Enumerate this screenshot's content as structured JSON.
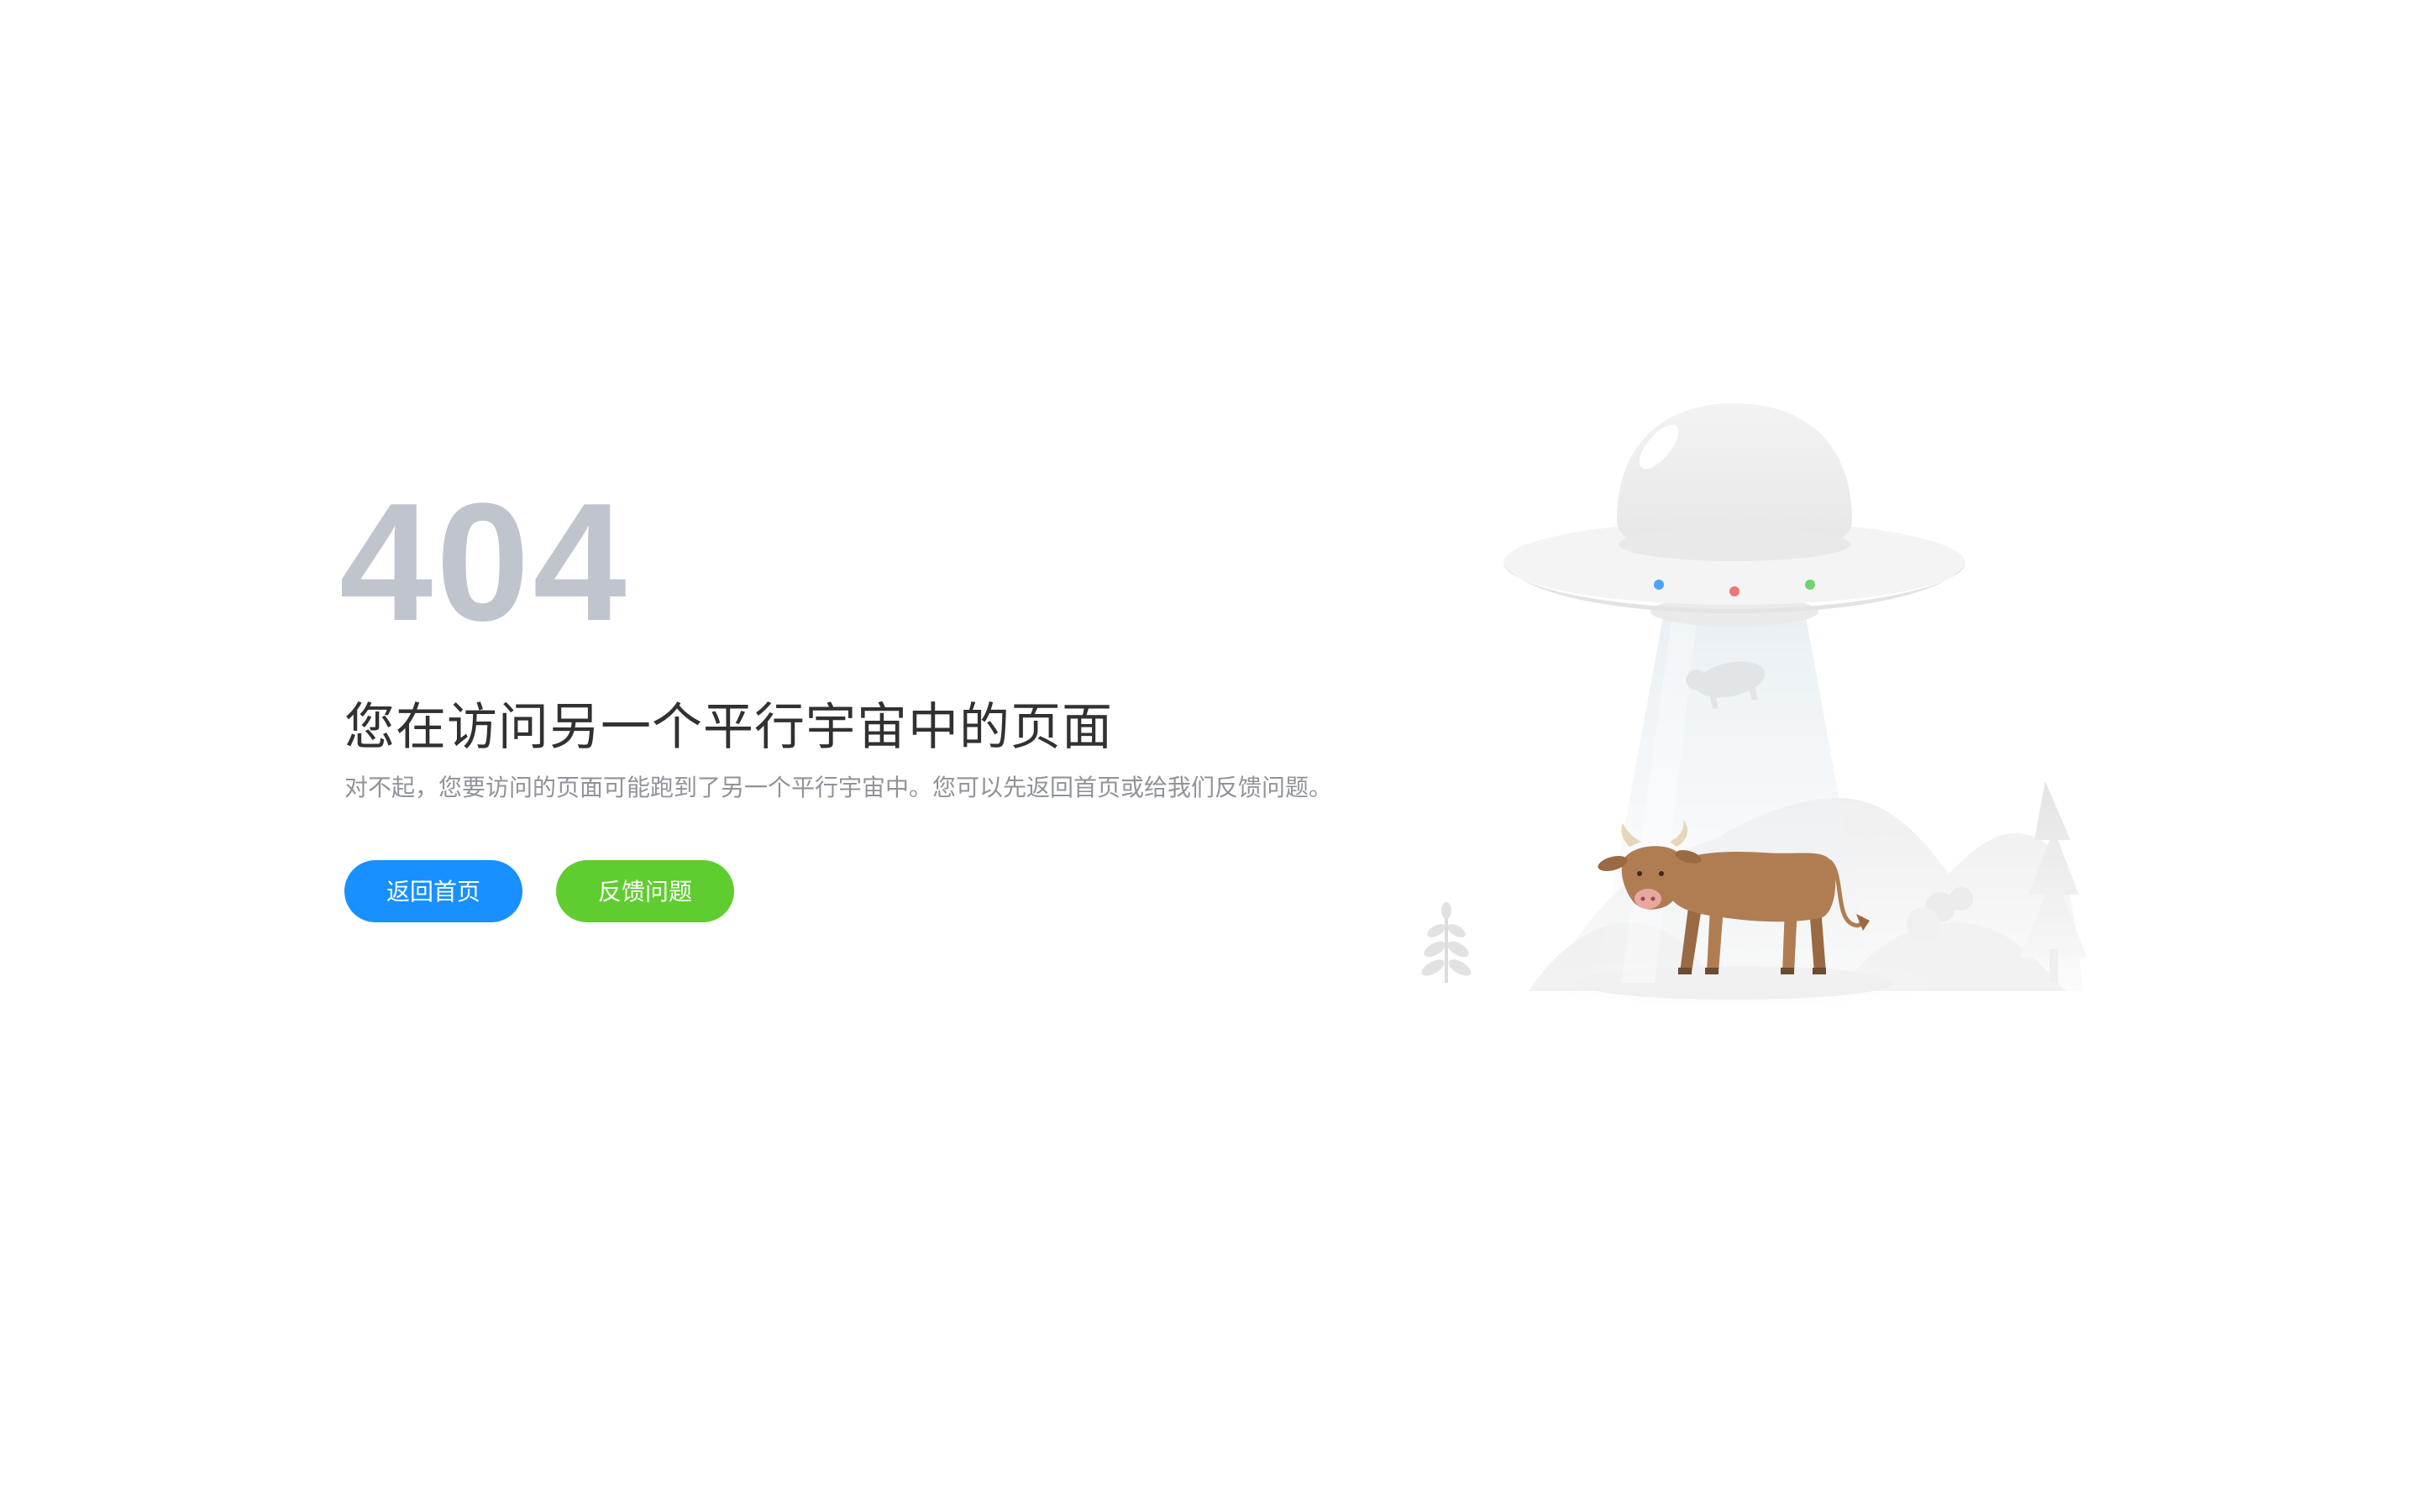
{
  "error": {
    "code": "404",
    "headline": "您在访问另一个平行宇宙中的页面",
    "description": "对不起，您要访问的页面可能跑到了另一个平行宇宙中。您可以先返回首页或给我们反馈问题。"
  },
  "actions": {
    "home_label": "返回首页",
    "feedback_label": "反馈问题"
  },
  "colors": {
    "code": "#c0c4cc",
    "headline": "#303133",
    "description": "#909399",
    "primary": "#1890ff",
    "success": "#5fcd30",
    "cow": "#b07d52",
    "ufo_light_blue": "#4da3ff",
    "ufo_light_red": "#f07575",
    "ufo_light_green": "#6fd36f"
  },
  "illustration": {
    "icons": [
      "ufo-icon",
      "cow-icon",
      "tree-icon",
      "plant-icon",
      "hills-icon"
    ]
  }
}
